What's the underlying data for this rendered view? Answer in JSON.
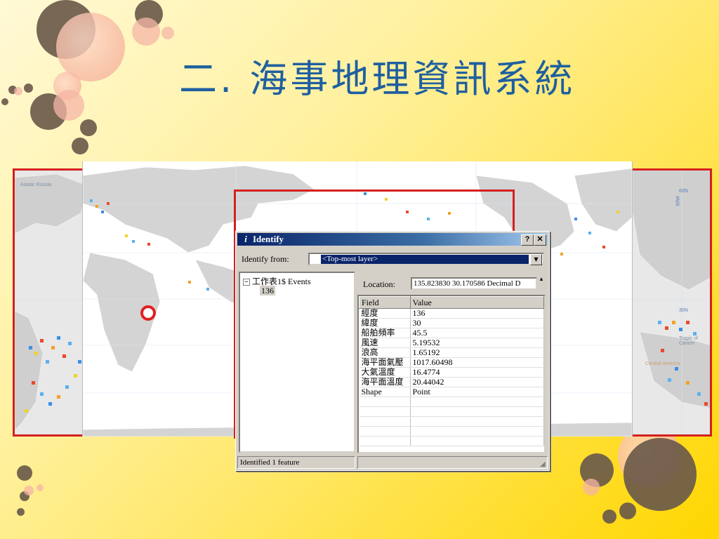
{
  "slide": {
    "title": "二. 海事地理資訊系統"
  },
  "map": {
    "labels": {
      "asiatic_russia": "Asiatic Russia",
      "tropic": "Tropic of Cancer",
      "central_america": "Central America",
      "lat_60n": "60N",
      "lat_30n": "30N",
      "lon_90w": "90W"
    }
  },
  "dialog": {
    "title": "Identify",
    "help_button": "?",
    "close_button": "✕",
    "identify_from_label": "Identify from:",
    "identify_from_value": "<Top-most layer>",
    "tree": {
      "layer": "工作表1$ Events",
      "feature": "136"
    },
    "location_label": "Location:",
    "location_value": "135.823830  30.170586 Decimal D",
    "columns": [
      "Field",
      "Value"
    ],
    "rows": [
      {
        "field": "經度",
        "value": "136"
      },
      {
        "field": "緯度",
        "value": "30"
      },
      {
        "field": "船舶頻率",
        "value": "45.5"
      },
      {
        "field": "風速",
        "value": "5.19532"
      },
      {
        "field": "浪高",
        "value": "1.65192"
      },
      {
        "field": "海平面氣壓",
        "value": "1017.60498"
      },
      {
        "field": "大氣溫度",
        "value": "16.4774"
      },
      {
        "field": "海平面溫度",
        "value": "20.44042"
      },
      {
        "field": "Shape",
        "value": "Point"
      }
    ],
    "status": "Identified 1 feature"
  }
}
